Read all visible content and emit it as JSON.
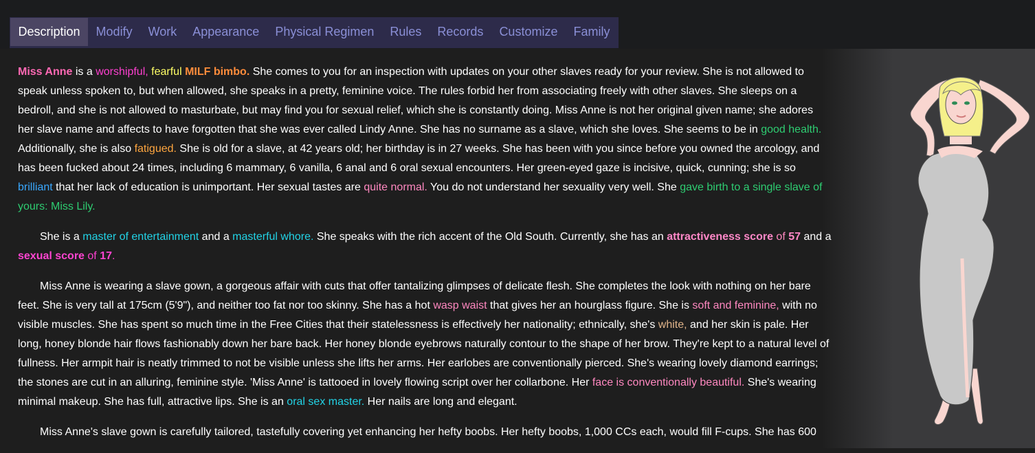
{
  "tabs": [
    {
      "label": "Description"
    },
    {
      "label": "Modify"
    },
    {
      "label": "Work"
    },
    {
      "label": "Appearance"
    },
    {
      "label": "Physical Regimen"
    },
    {
      "label": "Rules"
    },
    {
      "label": "Records"
    },
    {
      "label": "Customize"
    },
    {
      "label": "Family"
    }
  ],
  "active_tab": "Description",
  "p1": {
    "name": "Miss Anne",
    "t1": " is a ",
    "worshipful": "worshipful,",
    "fearful": " fearful",
    "milf": " MILF bimbo.",
    "t2": " She comes to you for an inspection with updates on your other slaves ready for your review. She is not allowed to speak unless spoken to, but when allowed, she speaks in a pretty, feminine voice. The rules forbid her from associating freely with other slaves. She sleeps on a bedroll, and she is not allowed to masturbate, but may find you for sexual relief, which she is constantly doing. Miss Anne is not her original given name; she adores her slave name and affects to have forgotten that she was ever called Lindy Anne. She has no surname as a slave, which she loves. She seems to be in ",
    "health": "good health.",
    "t3": " Additionally, she is also ",
    "fatigued": "fatigued.",
    "t4": " She is old for a slave, at 42 years old; her birthday is in 27 weeks. She has been with you since before you owned the arcology, and has been fucked about 24 times, including 6 mammary, 6 vanilla, 6 anal and 6 oral sexual encounters. Her green-eyed gaze is incisive, quick, cunning; she is so ",
    "brilliant": "brilliant",
    "t5": " that her lack of education is unimportant. Her sexual tastes are ",
    "normal": "quite normal.",
    "t6": " You do not understand her sexuality very well. She ",
    "birth": "gave birth to a single slave of yours: Miss Lily."
  },
  "p2": {
    "t1": "She is a ",
    "entertain": "master of entertainment",
    "t2": " and a ",
    "whore": "masterful whore.",
    "t3": " She speaks with the rich accent of the Old South. Currently, she has an ",
    "attr_label": "attractiveness score",
    "of1": " of ",
    "attr_val": "57",
    "t4": " and a ",
    "sex_label": "sexual score",
    "of2": " of ",
    "sex_val": "17",
    "end": "."
  },
  "p3": {
    "t1": "Miss Anne is wearing a slave gown, a gorgeous affair with cuts that offer tantalizing glimpses of delicate flesh. She completes the look with nothing on her bare feet. She is very tall at 175cm (5'9\"), and neither too fat nor too skinny. She has a hot ",
    "waist": "wasp waist",
    "t2": " that gives her an hourglass figure. She is ",
    "soft": "soft and feminine,",
    "t3": " with no visible muscles. She has spent so much time in the Free Cities that their statelessness is effectively her nationality; ethnically, she's ",
    "white": "white,",
    "t4": " and her skin is pale. Her long, honey blonde hair flows fashionably down her bare back. Her honey blonde eyebrows naturally contour to the shape of her brow. They're kept to a natural level of fullness. Her armpit hair is neatly trimmed to not be visible unless she lifts her arms. Her earlobes are conventionally pierced. She's wearing lovely diamond earrings; the stones are cut in an alluring, feminine style. 'Miss Anne' is tattooed in lovely flowing script over her collarbone. Her ",
    "face": "face is conventionally beautiful.",
    "t5": " She's wearing minimal makeup. She has full, attractive lips. She is an ",
    "oral": "oral sex master.",
    "t6": " Her nails are long and elegant."
  },
  "p4": {
    "t1": "Miss Anne's slave gown is carefully tailored, tastefully covering yet enhancing her hefty boobs. Her hefty boobs, 1,000 CCs each, would fill F-cups. She has 600"
  },
  "figure": {
    "hair": "#f5f08a",
    "skin": "#f9d6d0",
    "gown": "#c8c8c8",
    "eyes": "#2e8b57"
  }
}
